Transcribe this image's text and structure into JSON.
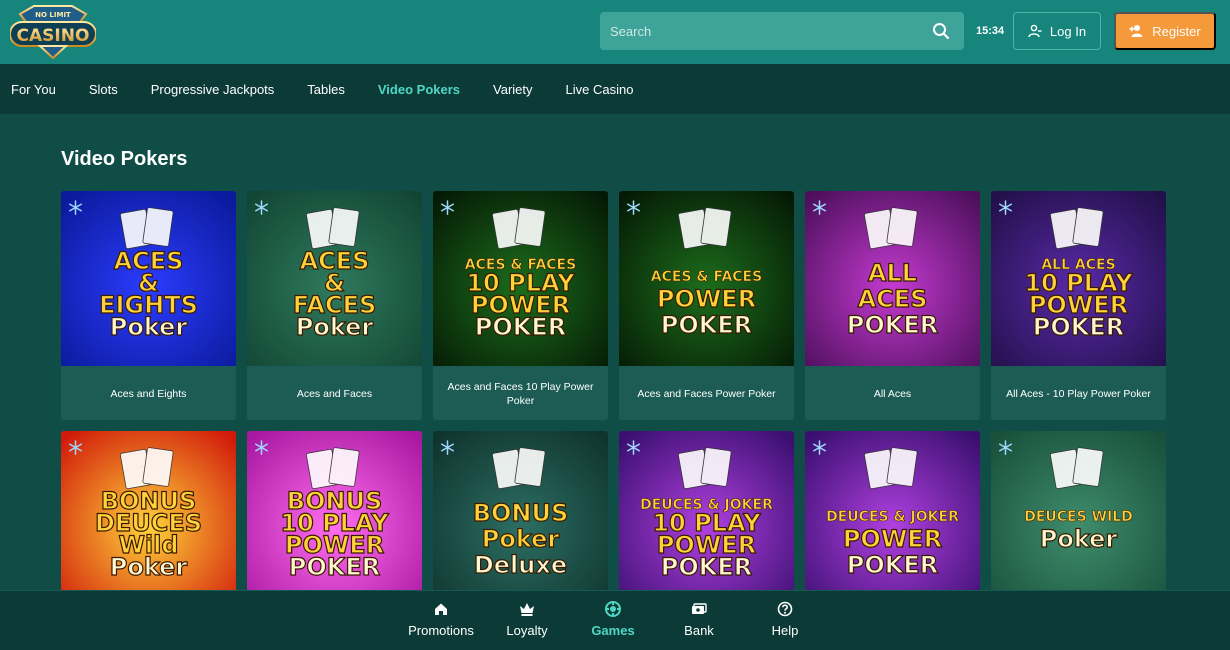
{
  "header": {
    "search_placeholder": "Search",
    "time": "15:34",
    "login_label": "Log In",
    "register_label": "Register",
    "logo_text": "CASINO",
    "logo_sub": "NO LIMIT"
  },
  "nav": {
    "items": [
      "For You",
      "Slots",
      "Progressive Jackpots",
      "Tables",
      "Video Pokers",
      "Variety",
      "Live Casino"
    ],
    "active": "Video Pokers"
  },
  "section": {
    "title": "Video Pokers"
  },
  "games": [
    {
      "label": "Aces and Eights",
      "art_lines": [
        "ACES",
        "&",
        "EIGHTS",
        "Poker"
      ],
      "theme": "blue"
    },
    {
      "label": "Aces and Faces",
      "art_lines": [
        "ACES",
        "&",
        "FACES",
        "Poker"
      ],
      "theme": "green-club"
    },
    {
      "label": "Aces and Faces 10 Play Power Poker",
      "art_lines": [
        "ACES & FACES",
        "10 PLAY",
        "POWER",
        "POKER"
      ],
      "theme": "dark-green"
    },
    {
      "label": "Aces and Faces Power Poker",
      "art_lines": [
        "ACES & FACES",
        "POWER",
        "POKER"
      ],
      "theme": "dark-green"
    },
    {
      "label": "All Aces",
      "art_lines": [
        "ALL",
        "ACES",
        "POKER"
      ],
      "theme": "magenta"
    },
    {
      "label": "All Aces - 10 Play Power Poker",
      "art_lines": [
        "ALL ACES",
        "10 PLAY",
        "POWER",
        "POKER"
      ],
      "theme": "purple"
    },
    {
      "label": "",
      "art_lines": [
        "BONUS",
        "DEUCES",
        "Wild",
        "Poker"
      ],
      "theme": "orange"
    },
    {
      "label": "",
      "art_lines": [
        "BONUS",
        "10 PLAY",
        "POWER",
        "POKER"
      ],
      "theme": "pink"
    },
    {
      "label": "",
      "art_lines": [
        "BONUS",
        "Poker",
        "Deluxe"
      ],
      "theme": "teal-stripes"
    },
    {
      "label": "",
      "art_lines": [
        "DEUCES & JOKER",
        "10 PLAY",
        "POWER",
        "POKER"
      ],
      "theme": "violet"
    },
    {
      "label": "",
      "art_lines": [
        "DEUCES & JOKER",
        "POWER",
        "POKER"
      ],
      "theme": "violet"
    },
    {
      "label": "",
      "art_lines": [
        "DEUCES WILD",
        "Poker"
      ],
      "theme": "green-heart"
    }
  ],
  "bottom_nav": {
    "items": [
      "Promotions",
      "Loyalty",
      "Games",
      "Bank",
      "Help"
    ],
    "active": "Games"
  },
  "colors": {
    "header_bg": "#17857c",
    "nav_bg": "#0c3b37",
    "page_bg": "#114d47",
    "accent": "#4fd7c6",
    "register": "#f59a3b"
  }
}
